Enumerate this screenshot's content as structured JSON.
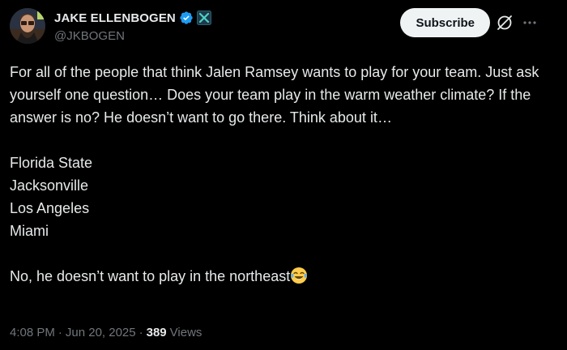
{
  "author": {
    "display_name": "JAKE ELLENBOGEN",
    "handle": "@JKBOGEN",
    "avatar_icon": "avatar-photo",
    "verified_icon": "verified-badge-icon",
    "affiliate_icon": "affiliate-badge-icon"
  },
  "actions": {
    "subscribe_label": "Subscribe",
    "grok_icon": "grok-icon",
    "more_icon": "more-icon"
  },
  "tweet": {
    "paragraph1": "For all of the people that think Jalen Ramsey wants to play for your team. Just ask yourself one question… Does your team play in the warm weather climate? If the answer is no? He doesn’t want to go there. Think about it…",
    "teams": [
      "Florida State",
      "Jacksonville",
      "Los Angeles",
      "Miami"
    ],
    "closing": "No, he doesn’t want to play in the northeast",
    "closing_emoji": "face-with-tears-of-joy"
  },
  "meta": {
    "time": "4:08 PM",
    "date": "Jun 20, 2025",
    "separator": "·",
    "views_count": "389",
    "views_label": "Views"
  },
  "colors": {
    "background": "#000000",
    "text": "#e7e9ea",
    "secondary_text": "#71767b",
    "verified_blue": "#1d9bf0",
    "subscribe_bg": "#eff3f4"
  }
}
